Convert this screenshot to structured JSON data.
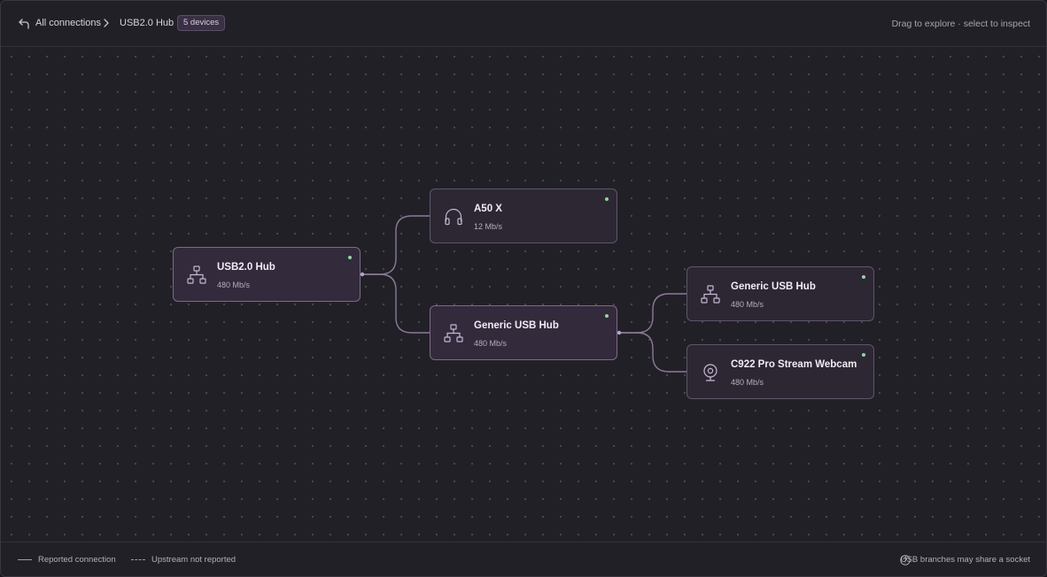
{
  "header": {
    "back_icon": "back-arrow-icon",
    "breadcrumb_root": "All connections",
    "breadcrumb_separator_icon": "chevron-right-icon",
    "breadcrumb_current": "USB2.0 Hub",
    "device_count_badge": "5 devices",
    "hint": "Drag to explore · select to inspect"
  },
  "nodes": [
    {
      "id": "usb2-hub",
      "name": "USB2.0 Hub",
      "speed": "480 Mb/s",
      "icon": "hub-icon",
      "status": "connected",
      "status_color": "#8fd6a2"
    },
    {
      "id": "a50x",
      "name": "A50 X",
      "speed": "12 Mb/s",
      "icon": "headphones-icon",
      "status": "connected",
      "status_color": "#8fd6a2"
    },
    {
      "id": "generic-hub-1",
      "name": "Generic USB Hub",
      "speed": "480 Mb/s",
      "icon": "hub-icon",
      "status": "connected",
      "status_color": "#8fd6a2"
    },
    {
      "id": "generic-hub-2",
      "name": "Generic USB Hub",
      "speed": "480 Mb/s",
      "icon": "hub-icon",
      "status": "connected",
      "status_color": "#8fd6a2"
    },
    {
      "id": "c922",
      "name": "C922 Pro Stream Webcam",
      "speed": "480 Mb/s",
      "icon": "webcam-icon",
      "status": "connected",
      "status_color": "#8fd6a2"
    }
  ],
  "connections": [
    {
      "from": "usb2-hub",
      "to": "a50x",
      "type": "reported"
    },
    {
      "from": "usb2-hub",
      "to": "generic-hub-1",
      "type": "reported"
    },
    {
      "from": "generic-hub-1",
      "to": "generic-hub-2",
      "type": "reported"
    },
    {
      "from": "generic-hub-1",
      "to": "c922",
      "type": "reported"
    }
  ],
  "footer": {
    "legend_reported": "Reported connection",
    "legend_upstream": "Upstream not reported",
    "help_icon": "question-circle-icon",
    "help_text": "USB branches may share a socket"
  },
  "colors": {
    "accent": "#7a6a88",
    "status_ok": "#8fd6a2",
    "link": "#8a7a98"
  }
}
